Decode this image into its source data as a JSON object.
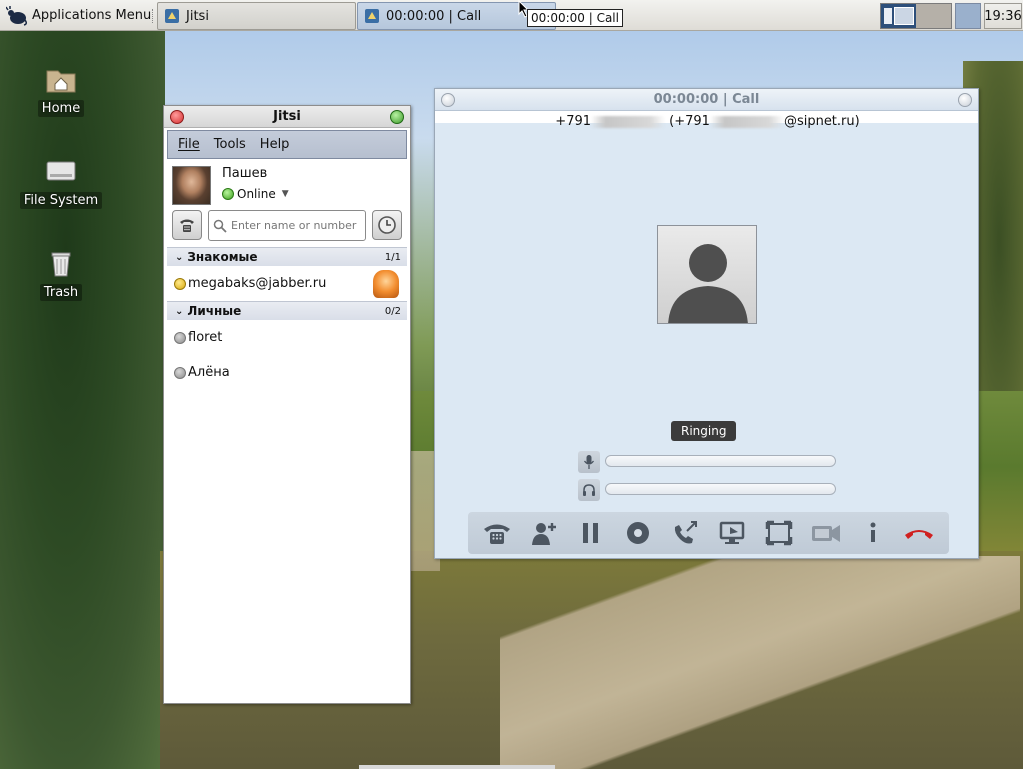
{
  "panel": {
    "app_menu_label": "Applications Menu",
    "tasks": [
      {
        "label": "Jitsi"
      },
      {
        "label": "00:00:00 | Call"
      }
    ],
    "tooltip": "00:00:00 | Call",
    "clock": "19:36"
  },
  "desktop": {
    "icons": [
      {
        "label": "Home",
        "icon": "home-folder-icon"
      },
      {
        "label": "File System",
        "icon": "drive-icon"
      },
      {
        "label": "Trash",
        "icon": "trash-icon"
      }
    ]
  },
  "jitsi": {
    "title": "Jitsi",
    "menu": [
      {
        "label": "File"
      },
      {
        "label": "Tools"
      },
      {
        "label": "Help"
      }
    ],
    "account_name": "Пашев",
    "status": "Online",
    "search_placeholder": "Enter name or number",
    "groups": [
      {
        "name": "Знакомые",
        "count": "1/1",
        "contacts": [
          {
            "name": "megabaks@jabber.ru",
            "status": "away"
          }
        ]
      },
      {
        "name": "Личные",
        "count": "0/2",
        "contacts": [
          {
            "name": "floret",
            "status": "offline"
          },
          {
            "name": "Алёна",
            "status": "offline"
          }
        ]
      }
    ]
  },
  "call": {
    "title": "00:00:00 | Call",
    "callee_prefix": "+791",
    "callee_middle": "(+791",
    "callee_suffix": "@sipnet.ru)",
    "state": "Ringing",
    "toolbar": [
      "dialpad-icon",
      "add-participant-icon",
      "hold-icon",
      "record-icon",
      "transfer-icon",
      "desktop-share-icon",
      "fullscreen-icon",
      "video-icon",
      "info-icon",
      "hangup-icon"
    ],
    "colors": {
      "hangup": "#d02020",
      "window_bg": "#dce8f3"
    }
  }
}
